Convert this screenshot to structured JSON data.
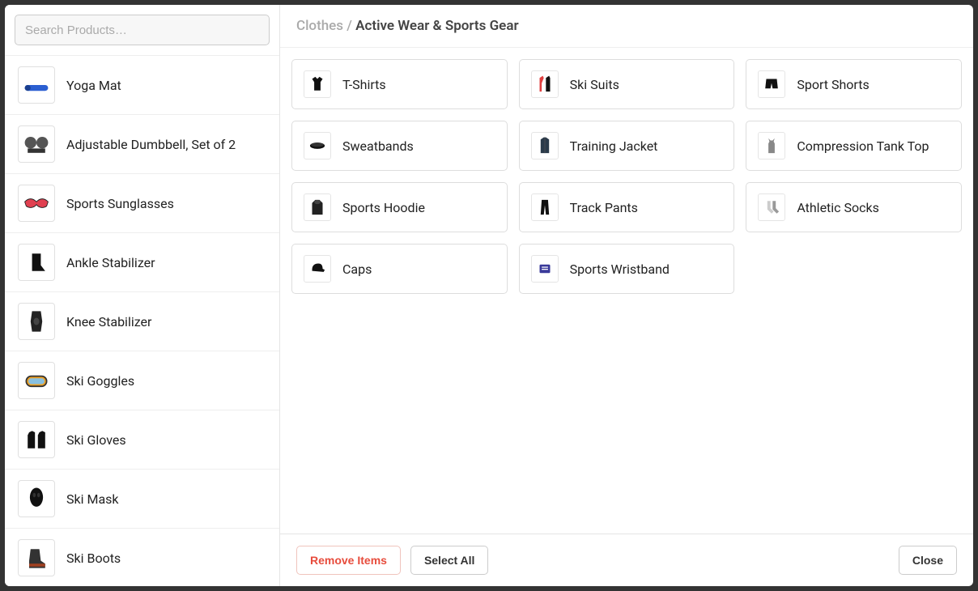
{
  "search": {
    "placeholder": "Search Products…"
  },
  "breadcrumb": {
    "prefix": "Clothes /",
    "current": "Active Wear & Sports Gear"
  },
  "sidebar": {
    "items": [
      {
        "label": "Yoga Mat",
        "icon": "yoga-mat"
      },
      {
        "label": "Adjustable Dumbbell, Set of 2",
        "icon": "dumbbell"
      },
      {
        "label": "Sports Sunglasses",
        "icon": "sunglasses"
      },
      {
        "label": "Ankle Stabilizer",
        "icon": "ankle-brace"
      },
      {
        "label": "Knee Stabilizer",
        "icon": "knee-brace"
      },
      {
        "label": "Ski Goggles",
        "icon": "goggles"
      },
      {
        "label": "Ski Gloves",
        "icon": "gloves"
      },
      {
        "label": "Ski Mask",
        "icon": "mask"
      },
      {
        "label": "Ski Boots",
        "icon": "boots"
      }
    ]
  },
  "grid": {
    "items": [
      {
        "label": "T-Shirts",
        "icon": "tshirt"
      },
      {
        "label": "Ski Suits",
        "icon": "ski-suit"
      },
      {
        "label": "Sport Shorts",
        "icon": "shorts"
      },
      {
        "label": "Sweatbands",
        "icon": "sweatband"
      },
      {
        "label": "Training Jacket",
        "icon": "jacket"
      },
      {
        "label": "Compression Tank Top",
        "icon": "tank"
      },
      {
        "label": "Sports Hoodie",
        "icon": "hoodie"
      },
      {
        "label": "Track Pants",
        "icon": "pants"
      },
      {
        "label": "Athletic Socks",
        "icon": "socks"
      },
      {
        "label": "Caps",
        "icon": "cap"
      },
      {
        "label": "Sports Wristband",
        "icon": "wristband"
      }
    ]
  },
  "footer": {
    "remove_label": "Remove Items",
    "select_all_label": "Select All",
    "close_label": "Close"
  }
}
